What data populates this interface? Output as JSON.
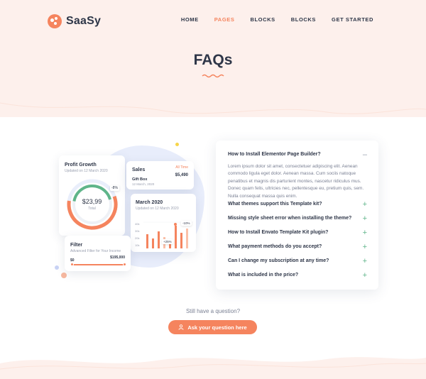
{
  "brand": {
    "name": "SaaSy"
  },
  "nav": {
    "items": [
      {
        "label": "HOME",
        "active": false
      },
      {
        "label": "PAGES",
        "active": true
      },
      {
        "label": "BLOCKS",
        "active": false
      },
      {
        "label": "BLOCKS",
        "active": false
      },
      {
        "label": "GET STARTED",
        "active": false
      }
    ]
  },
  "page": {
    "title": "FAQs"
  },
  "illustration": {
    "profit": {
      "title": "Profit Growth",
      "subtitle": "Updated on 12 March 2020",
      "value": "$23,99",
      "value_label": "Total",
      "badge": "-8%"
    },
    "sales": {
      "title": "Sales",
      "link": "All Time",
      "item": "Gift Box",
      "item_date": "12 March, 2020",
      "amount": "$5,490"
    },
    "march": {
      "title": "March 2020",
      "subtitle": "Updated on 12 March 2020",
      "badge_top": "-10%",
      "badge_mid": "+25%",
      "y_ticks": [
        "40k",
        "30k",
        "20k",
        "10k"
      ]
    },
    "filter": {
      "title": "Filter",
      "subtitle": "Advanced Filter for Your Income",
      "min": "$0",
      "max": "$195,000"
    }
  },
  "faq": {
    "items": [
      {
        "question": "How to Install Elementor Page Builder?",
        "open": true,
        "sign": "–"
      },
      {
        "question": "What themes support this Template kit?",
        "open": false,
        "sign": "+"
      },
      {
        "question": "Missing style sheet error when installing the theme?",
        "open": false,
        "sign": "+"
      },
      {
        "question": "How to Install Envato Template Kit plugin?",
        "open": false,
        "sign": "+"
      },
      {
        "question": "What payment methods do you accept?",
        "open": false,
        "sign": "+"
      },
      {
        "question": "Can I change my subscription at any time?",
        "open": false,
        "sign": "+"
      },
      {
        "question": "What is included in the price?",
        "open": false,
        "sign": "+"
      }
    ],
    "answer": "Lorem ipsum dolor sit amet, consectetuer adipiscing elit. Aenean commodo ligula eget dolor. Aenean massa. Cum sociis natoque penatibus et magnis dis parturient montes, nascetur ridiculus mus. Donec quam felis, ultricies nec, pellentesque eu, pretium quis, sem. Nulla consequat massa quis enim."
  },
  "cta": {
    "prompt": "Still have a question?",
    "button_label": "Ask your question here",
    "icon": "user-icon"
  },
  "colors": {
    "accent": "#f5845e",
    "dark": "#2e3648",
    "green": "#5fb58a",
    "hero_bg": "#fdf0ec"
  }
}
